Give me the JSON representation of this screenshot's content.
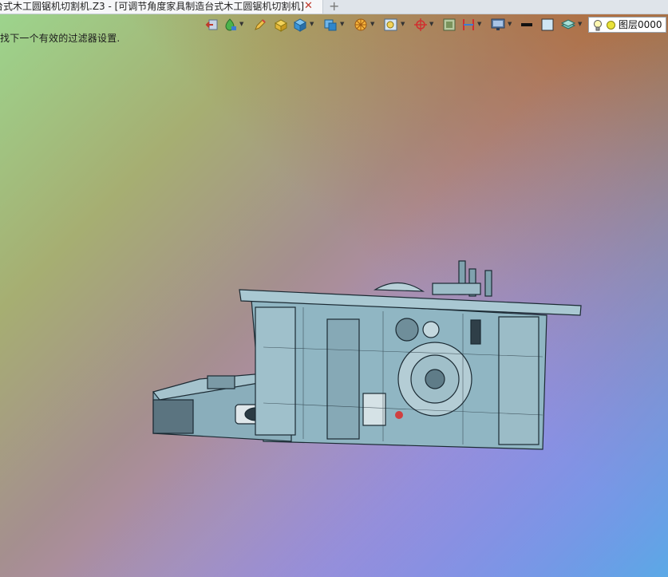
{
  "window": {
    "tab_title": "台式木工圆锯机切割机.Z3 - [可调节角度家具制造台式木工圆锯机切割机]",
    "tab_close": "✕",
    "tab_add": "+"
  },
  "status_message": "找下一个有效的过滤器设置.",
  "toolbar": {
    "items": [
      {
        "icon": "exit-view-icon"
      },
      {
        "icon": "render-style-icon"
      },
      {
        "icon": "pen-icon"
      },
      {
        "icon": "shaded-box-icon"
      },
      {
        "icon": "solid-cube-icon"
      },
      {
        "icon": "view-cube-icon"
      },
      {
        "icon": "orient-wheel-icon"
      },
      {
        "icon": "zoom-fit-icon"
      },
      {
        "icon": "crosshair-icon"
      },
      {
        "icon": "frame-select-icon"
      },
      {
        "icon": "section-plane-icon"
      },
      {
        "icon": "monitor-icon"
      },
      {
        "icon": "line-weight-icon"
      },
      {
        "icon": "color-swatch-icon"
      },
      {
        "icon": "layer-stack-icon"
      }
    ]
  },
  "layer": {
    "label": "图层0000",
    "icon": "lightbulb-icon",
    "color": "#e9e23a"
  },
  "colors": {
    "model_fill": "#8fb3c0",
    "model_stroke": "#1b2a33"
  }
}
